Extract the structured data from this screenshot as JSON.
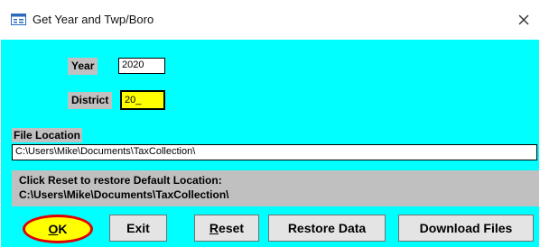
{
  "window": {
    "title": "Get Year and Twp/Boro",
    "close_glyph": "×",
    "icons": {
      "title": "form-window-icon",
      "close": "close-icon"
    }
  },
  "form": {
    "year_label": "Year",
    "year_value": "2020",
    "district_label": "District",
    "district_value": "20_",
    "file_location_label": "File Location",
    "file_location_value": "C:\\Users\\Mike\\Documents\\TaxCollection\\",
    "reset_info_line1": "Click Reset to restore Default Location:",
    "reset_info_line2": "C:\\Users\\Mike\\Documents\\TaxCollection\\"
  },
  "buttons": {
    "ok": {
      "accel": "O",
      "rest": "K"
    },
    "exit": "Exit",
    "reset": {
      "accel": "R",
      "rest": "eset"
    },
    "restore": "Restore Data",
    "download": "Download Files"
  },
  "colors": {
    "client_background": "#00ffff",
    "label_background": "#c0c0c0",
    "highlight_field": "#ffff00",
    "ok_ring": "#e00000"
  }
}
